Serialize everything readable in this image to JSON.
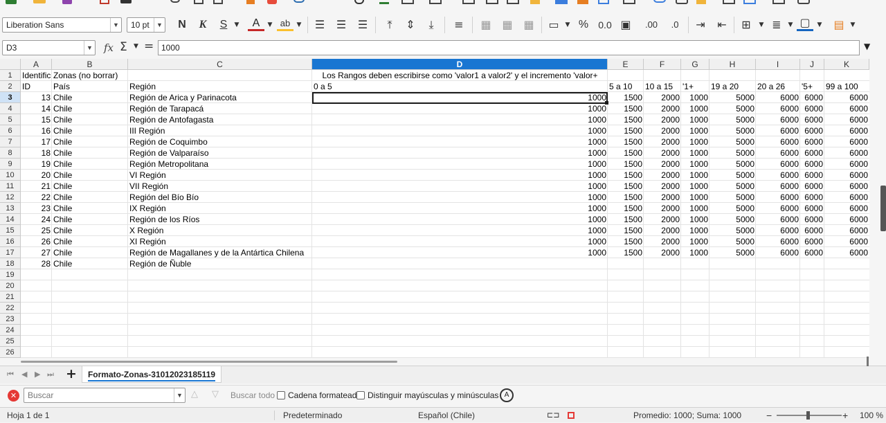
{
  "toolbar": {
    "font_name": "Liberation Sans",
    "font_size": "10 pt",
    "bold_label": "N",
    "italic_label": "K",
    "underline_label": "S",
    "font_color_label": "A",
    "highlight_label": "ab",
    "percent_label": "%",
    "decimal_label": "0.0",
    "add_decimal_label": ".00",
    "remove_decimal_label": ".0"
  },
  "formula_bar": {
    "cell_ref": "D3",
    "fx_label": "fx",
    "sum_label": "Σ",
    "equals_label": "=",
    "content": "1000"
  },
  "columns": [
    {
      "letter": "A"
    },
    {
      "letter": "B"
    },
    {
      "letter": "C"
    },
    {
      "letter": "D"
    },
    {
      "letter": "E"
    },
    {
      "letter": "F"
    },
    {
      "letter": "G"
    },
    {
      "letter": "H"
    },
    {
      "letter": "I"
    },
    {
      "letter": "J"
    },
    {
      "letter": "K"
    }
  ],
  "row_numbers": [
    "1",
    "2",
    "3",
    "4",
    "5",
    "6",
    "7",
    "8",
    "9",
    "10",
    "11",
    "12",
    "13",
    "14",
    "15",
    "16",
    "17",
    "18",
    "19",
    "20",
    "21",
    "22",
    "23",
    "24",
    "25",
    "26"
  ],
  "header_rows": {
    "row1": {
      "A": "Identific",
      "B": "Zonas (no borrar)",
      "D": "Los Rangos deben escribirse como 'valor1 a valor2' y el incremento 'valor+"
    },
    "row2": {
      "A": "ID",
      "B": "País",
      "C": "Región",
      "D": "0 a 5",
      "E": "5 a 10",
      "F": "10 a 15",
      "G": "'1+",
      "H": "19 a 20",
      "I": "20 a 26",
      "J": "'5+",
      "K": "99 a 100"
    }
  },
  "data_rows": [
    {
      "id": "13",
      "country": "Chile",
      "region": "Región de Arica y Parinacota",
      "vals": [
        "1000",
        "1500",
        "2000",
        "1000",
        "5000",
        "6000",
        "6000",
        "6000"
      ]
    },
    {
      "id": "14",
      "country": "Chile",
      "region": "Región de Tarapacá",
      "vals": [
        "1000",
        "1500",
        "2000",
        "1000",
        "5000",
        "6000",
        "6000",
        "6000"
      ]
    },
    {
      "id": "15",
      "country": "Chile",
      "region": "Región de Antofagasta",
      "vals": [
        "1000",
        "1500",
        "2000",
        "1000",
        "5000",
        "6000",
        "6000",
        "6000"
      ]
    },
    {
      "id": "16",
      "country": "Chile",
      "region": "III Región",
      "vals": [
        "1000",
        "1500",
        "2000",
        "1000",
        "5000",
        "6000",
        "6000",
        "6000"
      ]
    },
    {
      "id": "17",
      "country": "Chile",
      "region": "Región de Coquimbo",
      "vals": [
        "1000",
        "1500",
        "2000",
        "1000",
        "5000",
        "6000",
        "6000",
        "6000"
      ]
    },
    {
      "id": "18",
      "country": "Chile",
      "region": "Región de Valparaíso",
      "vals": [
        "1000",
        "1500",
        "2000",
        "1000",
        "5000",
        "6000",
        "6000",
        "6000"
      ]
    },
    {
      "id": "19",
      "country": "Chile",
      "region": "Región Metropolitana",
      "vals": [
        "1000",
        "1500",
        "2000",
        "1000",
        "5000",
        "6000",
        "6000",
        "6000"
      ]
    },
    {
      "id": "20",
      "country": "Chile",
      "region": "VI Región",
      "vals": [
        "1000",
        "1500",
        "2000",
        "1000",
        "5000",
        "6000",
        "6000",
        "6000"
      ]
    },
    {
      "id": "21",
      "country": "Chile",
      "region": "VII Región",
      "vals": [
        "1000",
        "1500",
        "2000",
        "1000",
        "5000",
        "6000",
        "6000",
        "6000"
      ]
    },
    {
      "id": "22",
      "country": "Chile",
      "region": "Región del Bío Bío",
      "vals": [
        "1000",
        "1500",
        "2000",
        "1000",
        "5000",
        "6000",
        "6000",
        "6000"
      ]
    },
    {
      "id": "23",
      "country": "Chile",
      "region": "IX Región",
      "vals": [
        "1000",
        "1500",
        "2000",
        "1000",
        "5000",
        "6000",
        "6000",
        "6000"
      ]
    },
    {
      "id": "24",
      "country": "Chile",
      "region": "Región de los Ríos",
      "vals": [
        "1000",
        "1500",
        "2000",
        "1000",
        "5000",
        "6000",
        "6000",
        "6000"
      ]
    },
    {
      "id": "25",
      "country": "Chile",
      "region": "X Región",
      "vals": [
        "1000",
        "1500",
        "2000",
        "1000",
        "5000",
        "6000",
        "6000",
        "6000"
      ]
    },
    {
      "id": "26",
      "country": "Chile",
      "region": "XI Región",
      "vals": [
        "1000",
        "1500",
        "2000",
        "1000",
        "5000",
        "6000",
        "6000",
        "6000"
      ]
    },
    {
      "id": "27",
      "country": "Chile",
      "region": "Región de Magallanes y de la Antártica Chilena",
      "vals": [
        "1000",
        "1500",
        "2000",
        "1000",
        "5000",
        "6000",
        "6000",
        "6000"
      ]
    },
    {
      "id": "28",
      "country": "Chile",
      "region": "Región de Ñuble",
      "vals": []
    }
  ],
  "tabs": {
    "add_label": "+",
    "active_sheet": "Formato-Zonas-31012023185119"
  },
  "find": {
    "placeholder": "Buscar",
    "find_all": "Buscar todo",
    "formatted_label": "Cadena formateada",
    "match_case_label": "Distinguir mayúsculas y minúsculas"
  },
  "status": {
    "sheet": "Hoja 1 de 1",
    "page_style": "Predeterminado",
    "language": "Español (Chile)",
    "summary": "Promedio: 1000; Suma: 1000",
    "zoom": "100 %"
  },
  "colors": {
    "selected_header": "#1976d2",
    "selected_row_header": "#cfe2f6",
    "font_color": "#c62828",
    "highlight_color": "#fbc02d",
    "border_color": "#1565c0"
  }
}
